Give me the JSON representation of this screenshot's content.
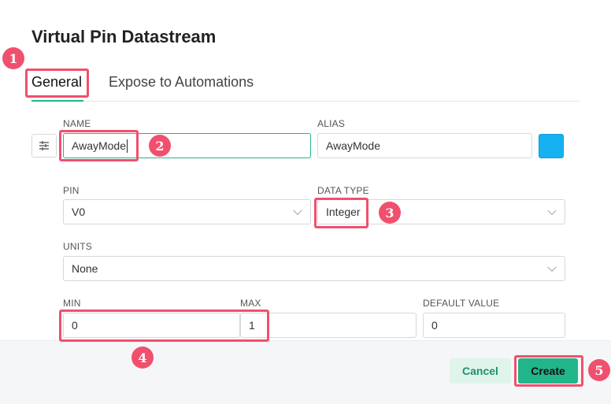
{
  "dialog": {
    "title": "Virtual Pin Datastream",
    "tabs": [
      {
        "label": "General",
        "active": true
      },
      {
        "label": "Expose to Automations",
        "active": false
      }
    ]
  },
  "form": {
    "name": {
      "label": "NAME",
      "value": "AwayMode"
    },
    "alias": {
      "label": "ALIAS",
      "value": "AwayMode"
    },
    "color": "#16b1f0",
    "pin": {
      "label": "PIN",
      "value": "V0"
    },
    "data_type": {
      "label": "DATA TYPE",
      "value": "Integer"
    },
    "units": {
      "label": "UNITS",
      "value": "None"
    },
    "min": {
      "label": "MIN",
      "value": "0"
    },
    "max": {
      "label": "MAX",
      "value": "1"
    },
    "default_value": {
      "label": "DEFAULT VALUE",
      "value": "0"
    }
  },
  "footer": {
    "cancel_label": "Cancel",
    "create_label": "Create"
  },
  "annotations": [
    "1",
    "2",
    "3",
    "4",
    "5"
  ],
  "colors": {
    "accent": "#23b58a",
    "highlight": "#f0506e"
  }
}
